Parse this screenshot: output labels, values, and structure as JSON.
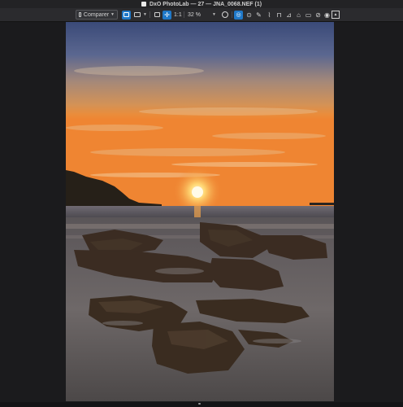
{
  "window": {
    "title": "DxO PhotoLab — 27 — JNA_0068.NEF (1)"
  },
  "toolbar": {
    "compare_label": "Comparer",
    "one_to_one_label": "1:1",
    "zoom_value": "32 %",
    "icons": [
      "compare-icon",
      "single-view-icon",
      "split-view-icon",
      "crop-view-icon",
      "move-tool-icon",
      "zoom-icon",
      "eyedropper-icon",
      "brush-icon",
      "curve-icon",
      "perspective-icon",
      "horizon-icon",
      "repair-icon",
      "local-adjust-icon",
      "eye-icon",
      "before-after-icon"
    ]
  },
  "colors": {
    "accent": "#1f78c8",
    "background": "#1b1b1d",
    "toolbar": "#2b2b2e"
  }
}
